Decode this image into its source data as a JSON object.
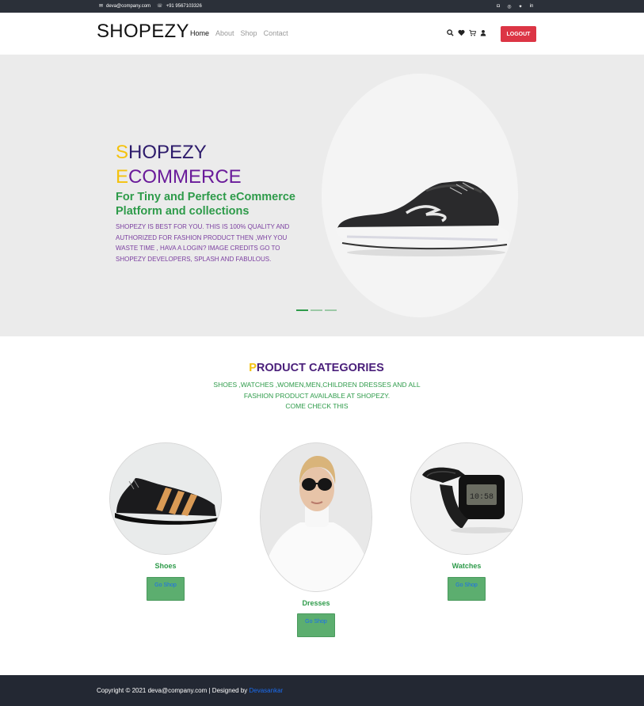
{
  "topbar": {
    "email": "deva@company.com",
    "phone": "+91 9567103326",
    "email_icon": "envelope-icon",
    "phone_icon": "phone-icon",
    "socials": [
      "instagram-icon",
      "dribbble-icon",
      "twitter-icon",
      "linkedin-icon"
    ]
  },
  "header": {
    "brand": "SHOPEZY",
    "nav": [
      "Home",
      "About",
      "Shop",
      "Contact"
    ],
    "active_nav": "Home",
    "icons": [
      "search-icon",
      "heart-icon",
      "cart-icon",
      "user-icon"
    ],
    "logout_label": "LOGOUT"
  },
  "hero": {
    "title_line1_first": "S",
    "title_line1_rest": "HOPEZY",
    "title_line2_first": "E",
    "title_line2_rest": "COMMERCE",
    "subtitle": "For Tiny and Perfect eCommerce Platform and collections",
    "description": "SHOPEZY IS BEST FOR YOU. THIS IS 100% QUALITY AND AUTHORIZED FOR FASHION PRODUCT THEN ,WHY YOU WASTE TIME , HAVA A LOGIN? IMAGE CREDITS GO TO SHOPEZY DEVELOPERS, SPLASH AND FABULOUS.",
    "slide_count": 3,
    "active_slide": 1
  },
  "categories": {
    "title_first": "P",
    "title_rest": "RODUCT CATEGORIES",
    "description_line1": "SHOES ,WATCHES ,WOMEN,MEN,CHILDREN DRESSES AND ALL FASHION PRODUCT AVAILABLE AT SHOPEZY.",
    "description_line2": "COME CHECK THIS",
    "items": [
      {
        "label": "Shoes",
        "button": "Go Shop"
      },
      {
        "label": "Dresses",
        "button": "Go Shop"
      },
      {
        "label": "Watches",
        "button": "Go Shop"
      }
    ]
  },
  "footer": {
    "copyright": "Copyright © 2021 deva@company.com | Designed by ",
    "designer": "Devasankar"
  },
  "colors": {
    "accent_red": "#dc3545",
    "accent_green": "#2e9b4a",
    "accent_yellow": "#f4c20d",
    "accent_purple": "#4a1f7a",
    "dark_bar": "#2b3039"
  }
}
